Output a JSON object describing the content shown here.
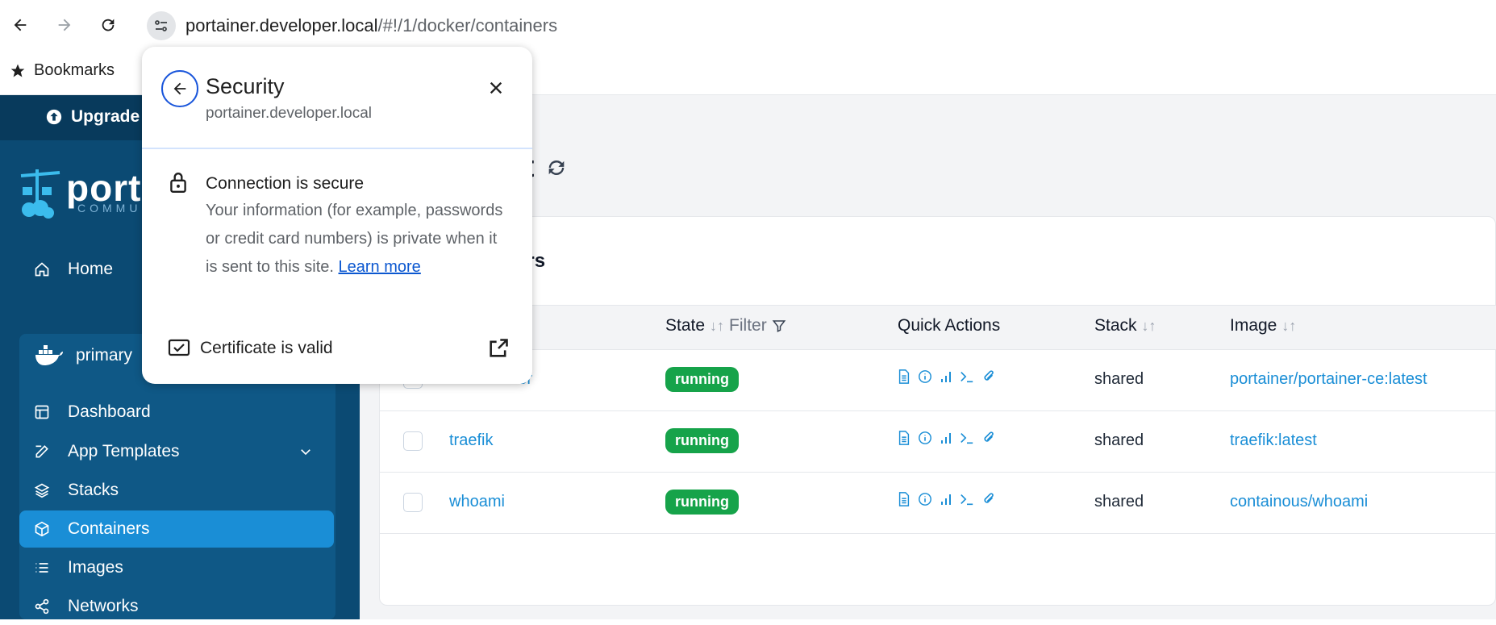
{
  "browser": {
    "url_host": "portainer.developer.local",
    "url_path": "/#!/1/docker/containers",
    "bookmarks_label": "Bookmarks"
  },
  "sidebar": {
    "upgrade_label": "Upgrade",
    "logo_text": "portainer",
    "logo_sub": "COMMUNITY",
    "home_label": "Home",
    "environment": "primary",
    "items": [
      {
        "label": "Dashboard",
        "icon": "dashboard-icon"
      },
      {
        "label": "App Templates",
        "icon": "edit-icon"
      },
      {
        "label": "Stacks",
        "icon": "layers-icon"
      },
      {
        "label": "Containers",
        "icon": "box-icon"
      },
      {
        "label": "Images",
        "icon": "list-icon"
      },
      {
        "label": "Networks",
        "icon": "share-icon"
      }
    ]
  },
  "main": {
    "title_fragment": "ist",
    "card_title_fragment": "ers",
    "columns": {
      "state": "State",
      "filter": "Filter",
      "quick_actions": "Quick Actions",
      "stack": "Stack",
      "image": "Image"
    },
    "rows": [
      {
        "name_fragment": "tainer",
        "state": "running",
        "stack": "shared",
        "image": "portainer/portainer-ce:latest"
      },
      {
        "name": "traefik",
        "state": "running",
        "stack": "shared",
        "image": "traefik:latest"
      },
      {
        "name": "whoami",
        "state": "running",
        "stack": "shared",
        "image": "containous/whoami"
      }
    ]
  },
  "popup": {
    "title": "Security",
    "subtitle": "portainer.developer.local",
    "connection_title": "Connection is secure",
    "connection_text": "Your information (for example, passwords or credit card numbers) is private when it is sent to this site.",
    "learn_more": "Learn more",
    "certificate": "Certificate is valid"
  },
  "colors": {
    "sidebar": "#0b4a73",
    "accent": "#1a8ed6",
    "running": "#16a34a"
  }
}
